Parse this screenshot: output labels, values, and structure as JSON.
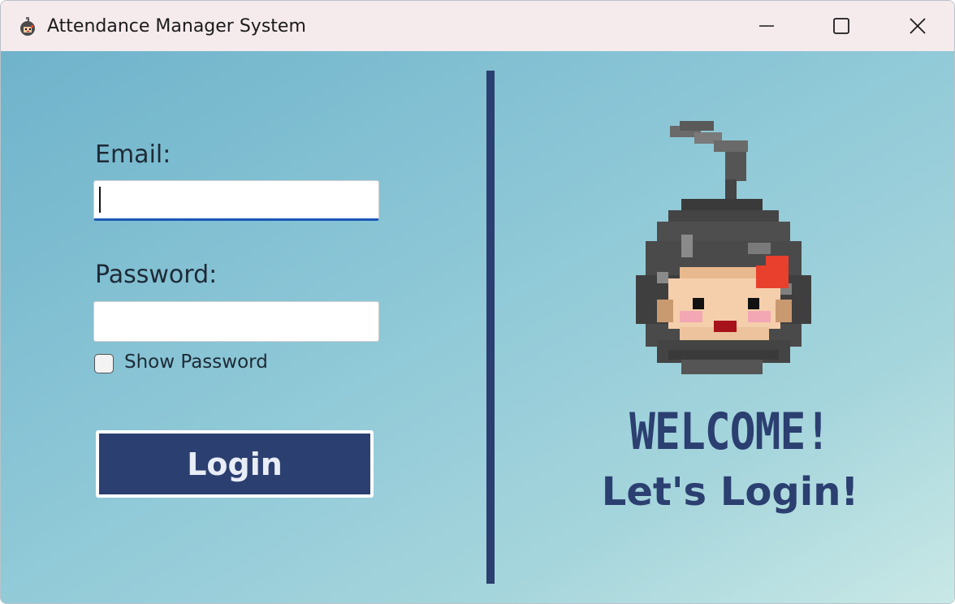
{
  "window": {
    "title": "Attendance Manager System",
    "icon": "pixel-avatar-icon",
    "controls": [
      "minimize-icon",
      "maximize-icon",
      "close-icon"
    ]
  },
  "form": {
    "email_label": "Email:",
    "email_value": "",
    "password_label": "Password:",
    "password_value": "",
    "show_password_label": "Show Password",
    "show_password_checked": false,
    "login_label": "Login"
  },
  "welcome": {
    "heading": "WELCOME!",
    "subheading": "Let's Login!",
    "avatar": "pixel-avatar-icon"
  },
  "colors": {
    "accent": "#2b3f70",
    "focus": "#1a57b4",
    "background_start": "#6fb3cb",
    "background_end": "#c9e8e6"
  }
}
